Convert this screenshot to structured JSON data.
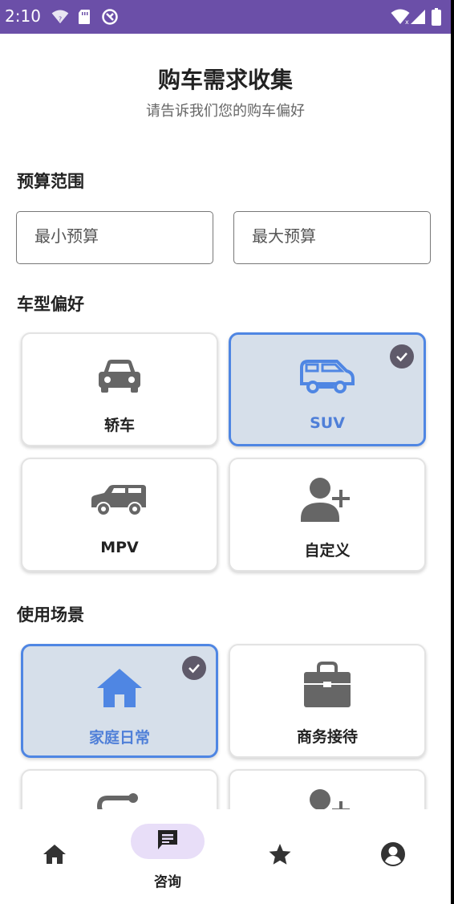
{
  "status_bar": {
    "time": "2:10"
  },
  "header": {
    "title": "购车需求收集",
    "subtitle": "请告诉我们您的购车偏好"
  },
  "budget": {
    "section_label": "预算范围",
    "min_placeholder": "最小预算",
    "max_placeholder": "最大预算"
  },
  "car_type": {
    "section_label": "车型偏好",
    "options": [
      {
        "label": "轿车",
        "icon": "sedan-icon",
        "selected": false
      },
      {
        "label": "SUV",
        "icon": "suv-icon",
        "selected": true
      },
      {
        "label": "MPV",
        "icon": "mpv-icon",
        "selected": false
      },
      {
        "label": "自定义",
        "icon": "person-add-icon",
        "selected": false
      }
    ]
  },
  "usage": {
    "section_label": "使用场景",
    "options": [
      {
        "label": "家庭日常",
        "icon": "home-icon",
        "selected": true
      },
      {
        "label": "商务接待",
        "icon": "briefcase-icon",
        "selected": false
      },
      {
        "label": "",
        "icon": "route-icon",
        "selected": false
      },
      {
        "label": "",
        "icon": "person-add-icon",
        "selected": false
      }
    ]
  },
  "bottom_nav": {
    "items": [
      {
        "label": "",
        "icon": "home-icon",
        "active": false
      },
      {
        "label": "咨询",
        "icon": "chat-icon",
        "active": true
      },
      {
        "label": "",
        "icon": "star-icon",
        "active": false
      },
      {
        "label": "",
        "icon": "account-icon",
        "active": false
      }
    ]
  },
  "colors": {
    "status_bar": "#6b4fa8",
    "accent": "#4f86e3",
    "selected_bg": "#d6dfea",
    "nav_pill": "#e8def8"
  }
}
